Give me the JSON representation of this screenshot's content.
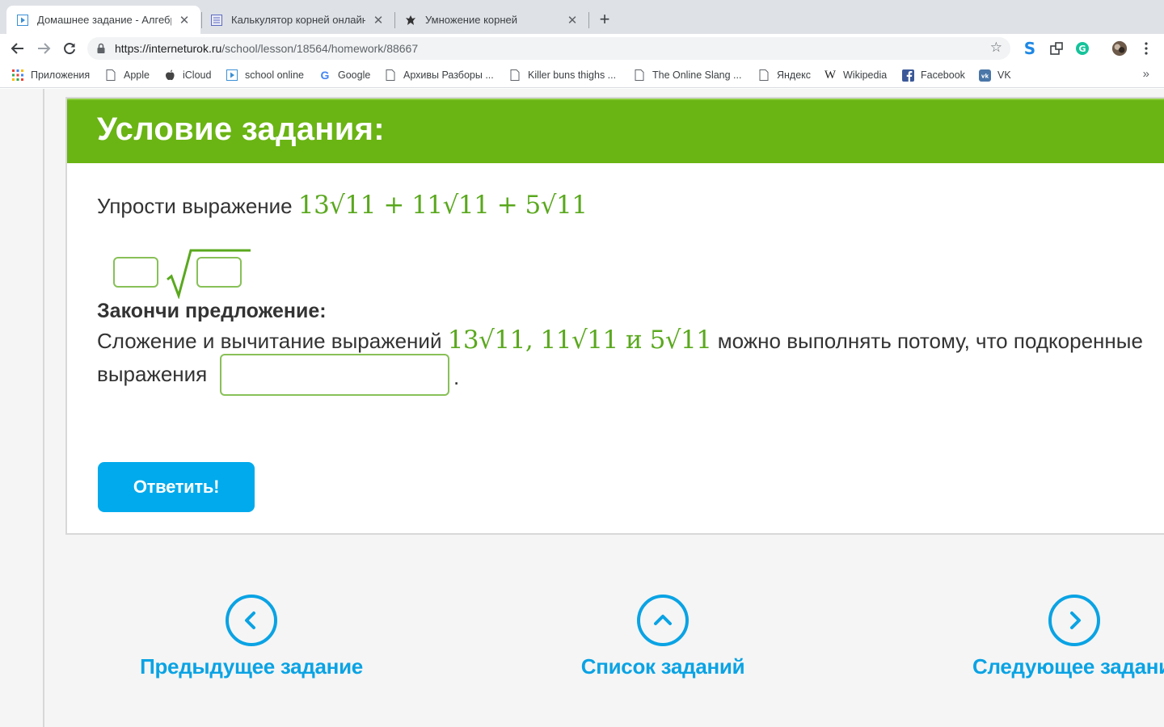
{
  "browser": {
    "tabs": [
      {
        "title": "Домашнее задание - Алгебра",
        "active": true
      },
      {
        "title": "Калькулятор корней онлайн",
        "active": false
      },
      {
        "title": "Умножение корней",
        "active": false
      }
    ],
    "url_host": "https://interneturok.ru",
    "url_path": "/school/lesson/18564/homework/88667",
    "bookmarks": [
      {
        "label": "Приложения",
        "icon": "apps-grid-icon"
      },
      {
        "label": "Apple",
        "icon": "page-icon"
      },
      {
        "label": "iCloud",
        "icon": "apple-icon"
      },
      {
        "label": "school online",
        "icon": "play-icon"
      },
      {
        "label": "Google",
        "icon": "google-icon"
      },
      {
        "label": "Архивы Разборы ...",
        "icon": "page-icon"
      },
      {
        "label": "Killer buns thighs ...",
        "icon": "page-icon"
      },
      {
        "label": "The Online Slang ...",
        "icon": "page-icon"
      },
      {
        "label": "Яндекс",
        "icon": "page-icon"
      },
      {
        "label": "Wikipedia",
        "icon": "wikipedia-icon"
      },
      {
        "label": "Facebook",
        "icon": "facebook-icon"
      },
      {
        "label": "VK",
        "icon": "vk-icon"
      }
    ],
    "bookmarks_more": "»"
  },
  "task": {
    "header": "Условие задания:",
    "prompt_text": "Упрости выражение",
    "expression": "13√11 + 11√11 + 5√11",
    "complete_heading": "Закончи предложение:",
    "sentence_part1": "Сложение и вычитание выражений",
    "sentence_math": "13√11, 11√11 и 5√11",
    "sentence_part2": "можно выполнять потому, что подкоренные",
    "sentence_part3": "выражения",
    "sentence_end": ".",
    "answer_button": "Ответить!"
  },
  "navigation": {
    "prev": "Предыдущее задание",
    "list": "Список заданий",
    "next": "Следующее задание"
  },
  "colors": {
    "header_green": "#6ab414",
    "math_green": "#5aa81e",
    "accent_blue": "#0aa3e4",
    "button_blue": "#00aaec"
  }
}
